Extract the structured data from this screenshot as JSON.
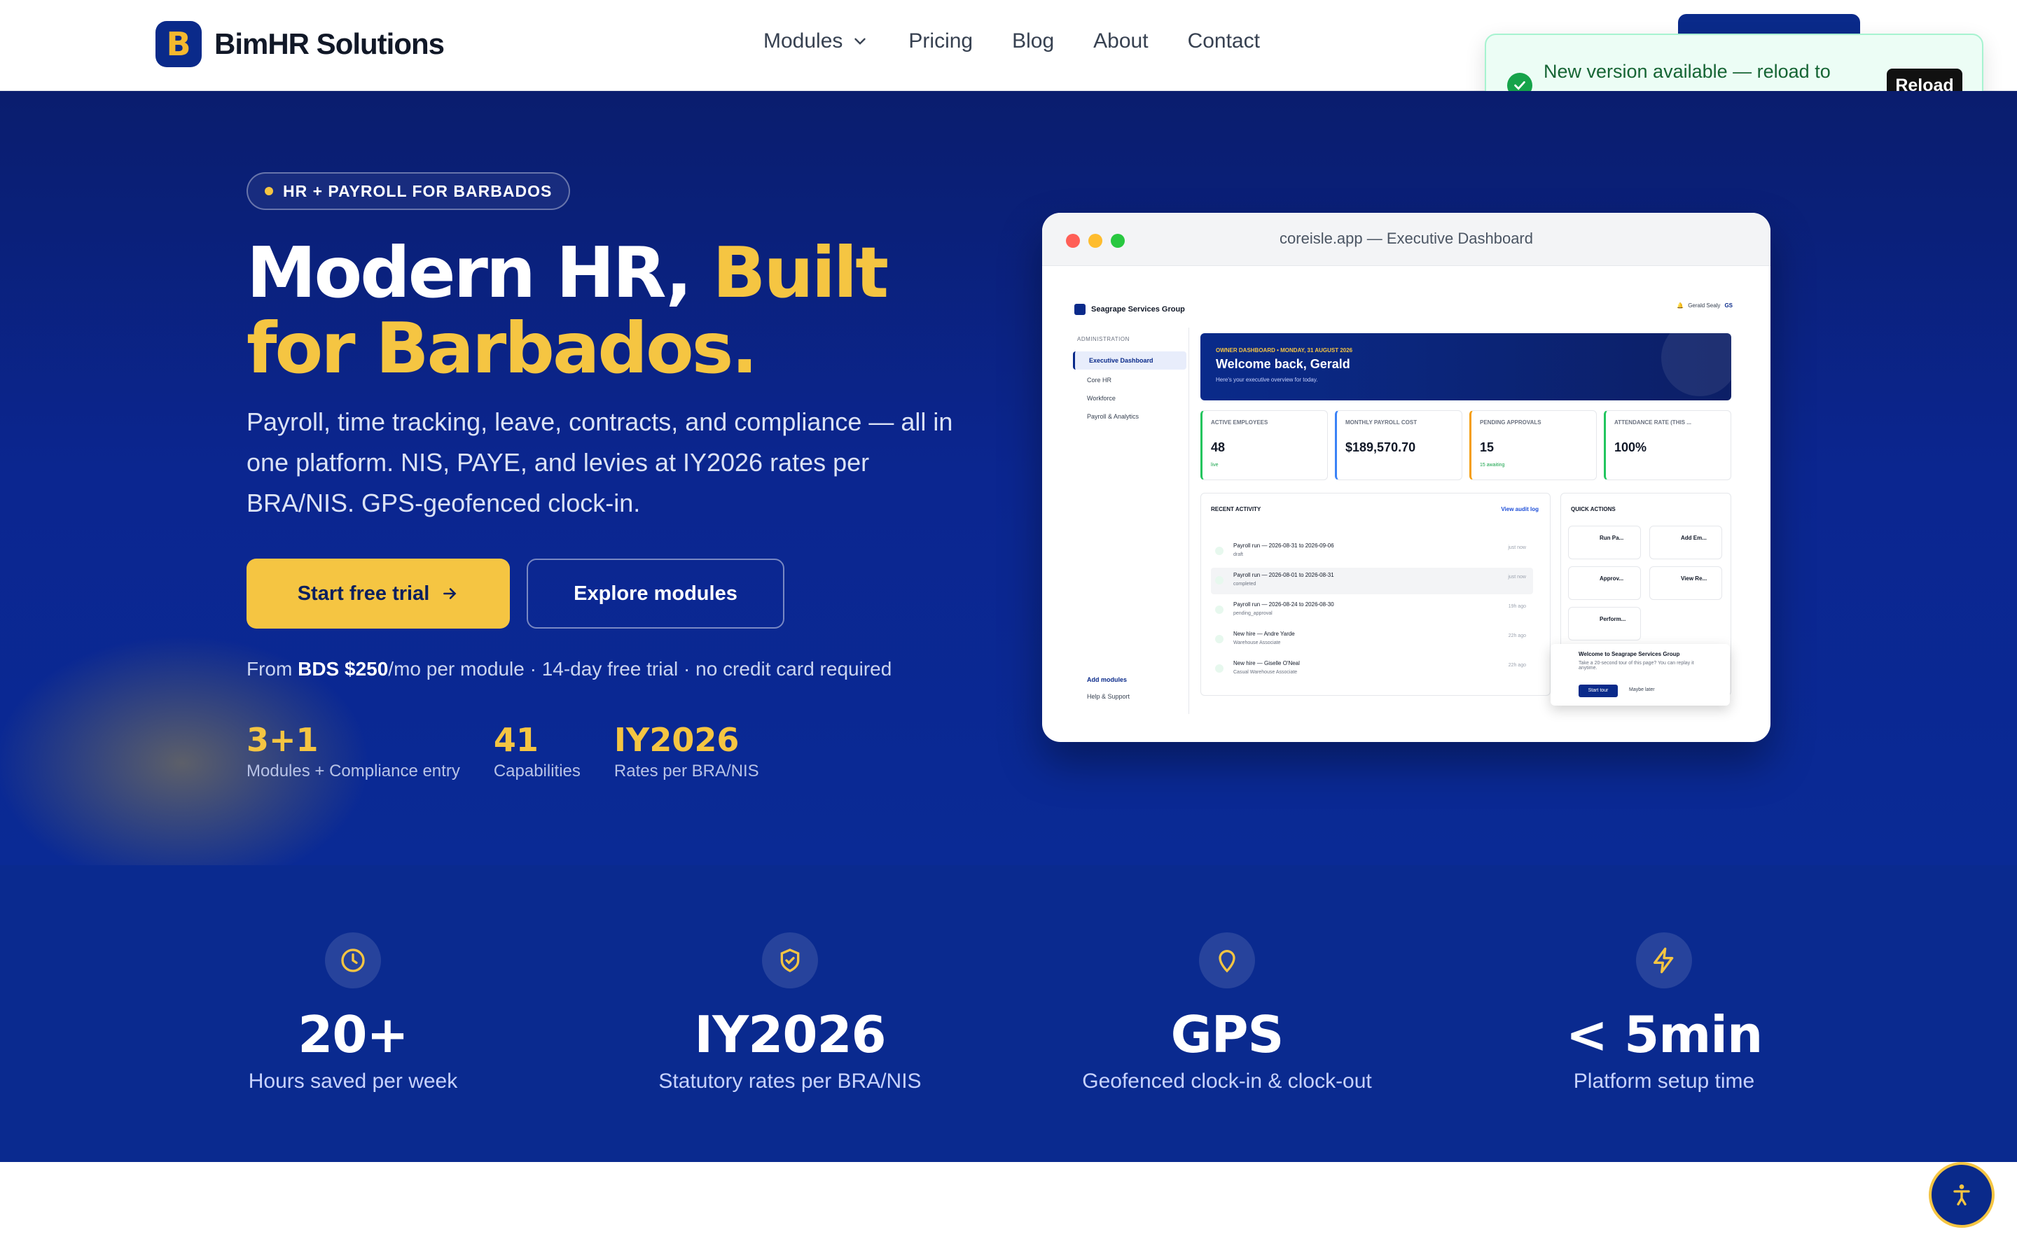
{
  "header": {
    "brand": "BimHR Solutions",
    "logo_letter": "B",
    "nav": [
      {
        "label": "Modules",
        "dropdown": true
      },
      {
        "label": "Pricing"
      },
      {
        "label": "Blog"
      },
      {
        "label": "About"
      },
      {
        "label": "Contact"
      }
    ]
  },
  "toast": {
    "message": "New version available — reload to update.",
    "action": "Reload"
  },
  "hero": {
    "badge": "HR + PAYROLL FOR BARBADOS",
    "title_white": "Modern HR, ",
    "title_accent": "Built for Barbados.",
    "subtitle": "Payroll, time tracking, leave, contracts, and compliance — all in one platform. NIS, PAYE, and levies at IY2026 rates per BRA/NIS. GPS-geofenced clock-in.",
    "cta_primary": "Start free trial",
    "cta_secondary": "Explore modules",
    "price_prefix": "From ",
    "price_bold": "BDS $250",
    "price_suffix": "/mo per module · 14-day free trial · no credit card required",
    "stats": [
      {
        "value": "3+1",
        "label": "Modules + Compliance entry"
      },
      {
        "value": "41",
        "label": "Capabilities"
      },
      {
        "value": "IY2026",
        "label": "Rates per BRA/NIS"
      }
    ]
  },
  "mock": {
    "window_title": "coreisle.app — Executive Dashboard",
    "org": "Seagrape Services Group",
    "user": "Gerald Sealy",
    "user_initials": "GS",
    "sidebar_heading": "ADMINISTRATION",
    "sidebar": [
      "Executive Dashboard",
      "Core HR",
      "Workforce",
      "Payroll & Analytics"
    ],
    "sidebar_footer": [
      "Add modules",
      "Help & Support"
    ],
    "welcome_eyebrow": "OWNER DASHBOARD • MONDAY, 31 AUGUST 2026",
    "welcome_title": "Welcome back, Gerald",
    "welcome_sub": "Here's your executive overview for today.",
    "kpis": [
      {
        "label": "ACTIVE EMPLOYEES",
        "value": "48",
        "foot": "live",
        "color": "#22c55e"
      },
      {
        "label": "MONTHLY PAYROLL COST",
        "value": "$189,570.70",
        "foot": "",
        "color": "#3b82f6"
      },
      {
        "label": "PENDING APPROVALS",
        "value": "15",
        "foot": "15 awaiting",
        "color": "#f59e0b"
      },
      {
        "label": "ATTENDANCE RATE (THIS ...",
        "value": "100%",
        "foot": "",
        "color": "#22c55e"
      }
    ],
    "activity_title": "RECENT ACTIVITY",
    "activity_link": "View audit log",
    "activity": [
      {
        "text": "Payroll run — 2026-08-31 to 2026-09-06",
        "sub": "draft",
        "time": "just now"
      },
      {
        "text": "Payroll run — 2026-08-01 to 2026-08-31",
        "sub": "completed",
        "time": "just now"
      },
      {
        "text": "Payroll run — 2026-08-24 to 2026-08-30",
        "sub": "pending_approval",
        "time": "19h ago"
      },
      {
        "text": "New hire — Andre Yarde",
        "sub": "Warehouse Associate",
        "time": "22h ago"
      },
      {
        "text": "New hire — Giselle O'Neal",
        "sub": "Casual Warehouse Associate",
        "time": "22h ago"
      }
    ],
    "quick_title": "QUICK ACTIONS",
    "quick": [
      "Run Pa...",
      "Add Em...",
      "Approv...",
      "View Re...",
      "Perform..."
    ],
    "tour_title": "Welcome to Seagrape Services Group",
    "tour_text": "Take a 20-second tour of this page? You can replay it anytime.",
    "tour_start": "Start tour",
    "tour_later": "Maybe later"
  },
  "band": {
    "stats": [
      {
        "icon": "clock-icon",
        "value": "20+",
        "label": "Hours saved per week"
      },
      {
        "icon": "shield-check-icon",
        "value": "IY2026",
        "label": "Statutory rates per BRA/NIS"
      },
      {
        "icon": "map-pin-icon",
        "value": "GPS",
        "label": "Geofenced clock-in & clock-out"
      },
      {
        "icon": "bolt-icon",
        "value": "< 5min",
        "label": "Platform setup time"
      }
    ]
  },
  "colors": {
    "navy": "#0a2a8a",
    "gold": "#f5c542",
    "success": "#16a34a"
  }
}
